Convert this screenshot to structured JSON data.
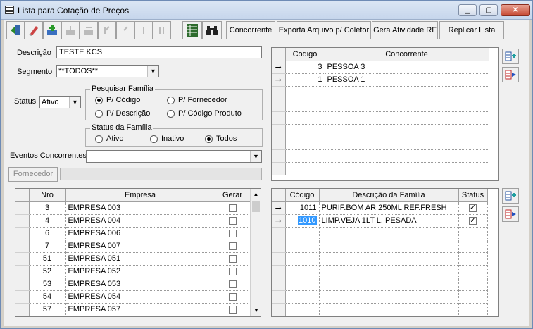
{
  "window": {
    "title": "Lista para Cotação de Preços",
    "minimize": "▁",
    "maximize": "▢",
    "close": "✕"
  },
  "toolbar": {
    "concorrente": "Concorrente",
    "exporta": "Exporta Arquivo p/ Coletor",
    "gera": "Gera Atividade RF",
    "replicar": "Replicar Lista"
  },
  "form": {
    "descricao_label": "Descrição",
    "descricao_value": "TESTE KCS",
    "segmento_label": "Segmento",
    "segmento_value": "**TODOS**",
    "status_label": "Status",
    "status_value": "Ativo",
    "pesquisar_title": "Pesquisar Família",
    "opt_codigo": "P/ Código",
    "opt_fornecedor": "P/ Fornecedor",
    "opt_descricao": "P/ Descrição",
    "opt_codprod": "P/ Código Produto",
    "statusfam_title": "Status da Família",
    "opt_ativo": "Ativo",
    "opt_inativo": "Inativo",
    "opt_todos": "Todos",
    "eventos_label": "Eventos Concorrentes",
    "eventos_value": "",
    "fornecedor_button": "Fornecedor",
    "fornecedor_value": ""
  },
  "concorrentes": {
    "headers": [
      "Codigo",
      "Concorrente"
    ],
    "rows": [
      {
        "codigo": "3",
        "nome": "PESSOA 3"
      },
      {
        "codigo": "1",
        "nome": "PESSOA 1"
      }
    ]
  },
  "empresas": {
    "headers": [
      "Nro",
      "Empresa",
      "Gerar"
    ],
    "rows": [
      {
        "nro": "3",
        "nome": "EMPRESA 003"
      },
      {
        "nro": "4",
        "nome": "EMPRESA 004"
      },
      {
        "nro": "6",
        "nome": "EMPRESA 006"
      },
      {
        "nro": "7",
        "nome": "EMPRESA 007"
      },
      {
        "nro": "51",
        "nome": "EMPRESA 051"
      },
      {
        "nro": "52",
        "nome": "EMPRESA 052"
      },
      {
        "nro": "53",
        "nome": "EMPRESA 053"
      },
      {
        "nro": "54",
        "nome": "EMPRESA 054"
      },
      {
        "nro": "57",
        "nome": "EMPRESA 057"
      }
    ]
  },
  "familias": {
    "headers": [
      "Código",
      "Descrição da Família",
      "Status"
    ],
    "rows": [
      {
        "codigo": "1011",
        "descricao": "PURIF.BOM AR 250ML REF.FRESH"
      },
      {
        "codigo": "1010",
        "descricao": "LIMP.VEJA 1LT L. PESADA"
      }
    ]
  },
  "glyphs": {
    "arrow": "➞",
    "dropdown": "▼",
    "scroll_up": "▲",
    "scroll_down": "▼"
  }
}
